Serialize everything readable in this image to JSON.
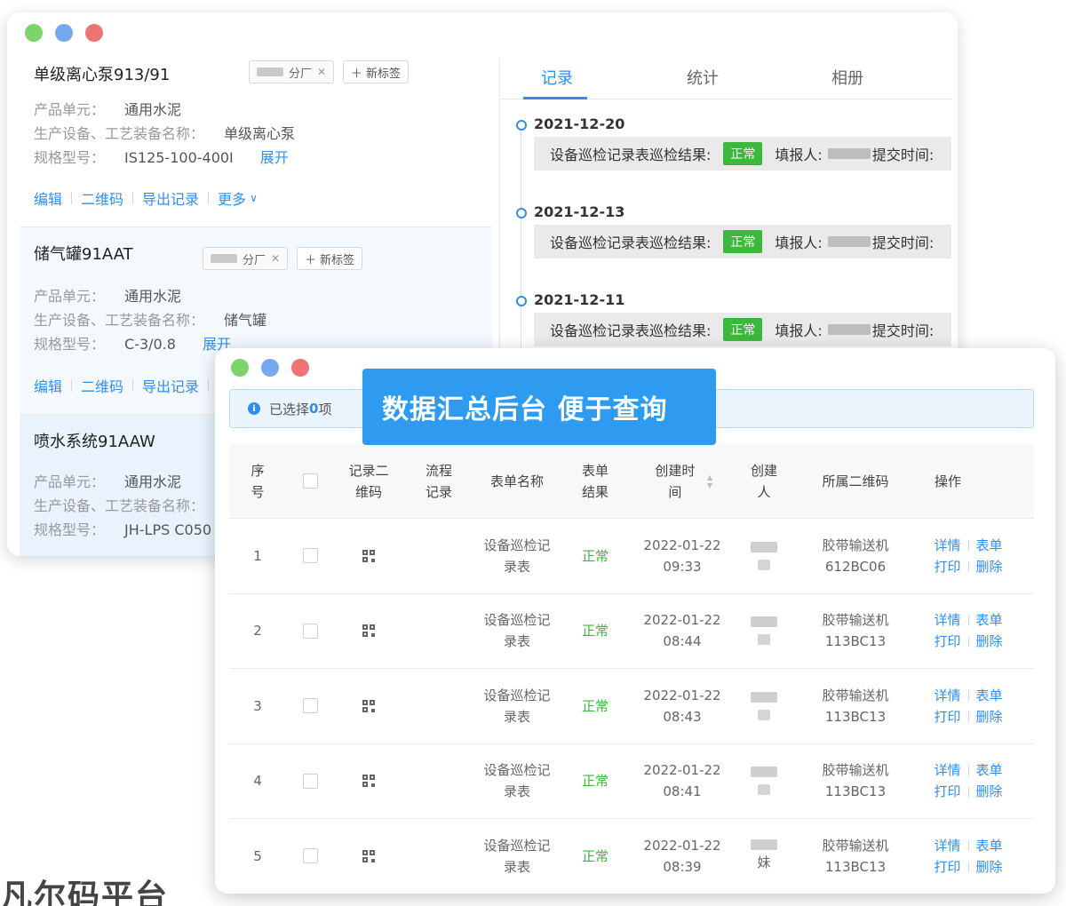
{
  "colors": {
    "dot_green": "#7ed36b",
    "dot_blue": "#76a7ef",
    "dot_red": "#ef7373",
    "accent": "#2f8ff0",
    "ok": "#3cb93c"
  },
  "back": {
    "cards": [
      {
        "title": "单级离心泵913/91",
        "tag": "分厂",
        "new_tag": "新标签",
        "fields": [
          {
            "label": "产品单元：",
            "value": "通用水泥"
          },
          {
            "label": "生产设备、工艺装备名称：",
            "value": "单级离心泵"
          },
          {
            "label": "规格型号：",
            "value": "IS125-100-400I",
            "expand": "展开"
          }
        ],
        "actions": [
          "编辑",
          "二维码",
          "导出记录",
          "更多"
        ]
      },
      {
        "title": "储气罐91AAT",
        "tag": "分厂",
        "new_tag": "新标签",
        "fields": [
          {
            "label": "产品单元：",
            "value": "通用水泥"
          },
          {
            "label": "生产设备、工艺装备名称：",
            "value": "储气罐"
          },
          {
            "label": "规格型号：",
            "value": "C-3/0.8",
            "expand": "展开"
          }
        ],
        "actions": [
          "编辑",
          "二维码",
          "导出记录"
        ]
      },
      {
        "title": "喷水系统91AAW",
        "fields": [
          {
            "label": "产品单元：",
            "value": "通用水泥"
          },
          {
            "label": "生产设备、工艺装备名称：",
            "value": ""
          },
          {
            "label": "规格型号：",
            "value": "JH-LPS C050"
          }
        ]
      }
    ],
    "tabs": [
      "记录",
      "统计",
      "相册"
    ],
    "timeline": [
      {
        "date": "2021-12-20",
        "text": "设备巡检记录表巡检结果:",
        "status": "正常",
        "filler": "填报人:",
        "submit": "提交时间:"
      },
      {
        "date": "2021-12-13",
        "text": "设备巡检记录表巡检结果:",
        "status": "正常",
        "filler": "填报人:",
        "submit": "提交时间:"
      },
      {
        "date": "2021-12-11",
        "text": "设备巡检记录表巡检结果:",
        "status": "正常",
        "filler": "填报人:",
        "submit": "提交时间:"
      }
    ]
  },
  "banner": "数据汇总后台  便于查询",
  "front": {
    "selected_prefix": "已选择",
    "selected_count": "0",
    "selected_suffix": "项",
    "headers": [
      "序号",
      "",
      "记录二维码",
      "流程记录",
      "表单名称",
      "表单结果",
      "创建时间",
      "创建人",
      "所属二维码",
      "操作"
    ],
    "rows": [
      {
        "no": "1",
        "form": "设备巡检记录表",
        "result": "正常",
        "date": "2022-01-22",
        "time": "09:33",
        "creator": "",
        "code_name": "胶带输送机",
        "code_id": "612BC06"
      },
      {
        "no": "2",
        "form": "设备巡检记录表",
        "result": "正常",
        "date": "2022-01-22",
        "time": "08:44",
        "creator": "",
        "code_name": "胶带输送机",
        "code_id": "113BC13"
      },
      {
        "no": "3",
        "form": "设备巡检记录表",
        "result": "正常",
        "date": "2022-01-22",
        "time": "08:43",
        "creator": "",
        "code_name": "胶带输送机",
        "code_id": "113BC13"
      },
      {
        "no": "4",
        "form": "设备巡检记录表",
        "result": "正常",
        "date": "2022-01-22",
        "time": "08:41",
        "creator": "",
        "code_name": "胶带输送机",
        "code_id": "113BC13"
      },
      {
        "no": "5",
        "form": "设备巡检记录表",
        "result": "正常",
        "date": "2022-01-22",
        "time": "08:39",
        "creator": "妹",
        "code_name": "胶带输送机",
        "code_id": "113BC13"
      }
    ],
    "ops": [
      "详情",
      "表单",
      "打印",
      "删除"
    ]
  },
  "watermark": "凡尔码平台"
}
